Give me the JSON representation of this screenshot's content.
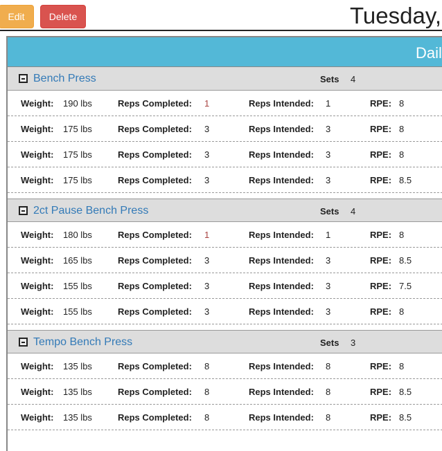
{
  "toolbar": {
    "edit_label": "Edit",
    "delete_label": "Delete"
  },
  "header": {
    "title": "Tuesday,"
  },
  "panel": {
    "title": "Dail"
  },
  "labels": {
    "weight": "Weight:",
    "reps_completed": "Reps Completed:",
    "reps_intended": "Reps Intended:",
    "rpe": "RPE:",
    "sets": "Sets"
  },
  "colors": {
    "panel_header": "#53b8d7",
    "link": "#337ab7",
    "edit": "#f0ad4e",
    "delete": "#d9534f",
    "incomplete": "#a94442"
  },
  "sections": [
    {
      "name": "Bench Press",
      "sets": "4",
      "rows": [
        {
          "weight": "190 lbs",
          "completed": "1",
          "intended": "1",
          "rpe": "8",
          "highlight": true
        },
        {
          "weight": "175 lbs",
          "completed": "3",
          "intended": "3",
          "rpe": "8"
        },
        {
          "weight": "175 lbs",
          "completed": "3",
          "intended": "3",
          "rpe": "8"
        },
        {
          "weight": "175 lbs",
          "completed": "3",
          "intended": "3",
          "rpe": "8.5"
        }
      ]
    },
    {
      "name": "2ct Pause Bench Press",
      "sets": "4",
      "rows": [
        {
          "weight": "180 lbs",
          "completed": "1",
          "intended": "1",
          "rpe": "8",
          "highlight": true
        },
        {
          "weight": "165 lbs",
          "completed": "3",
          "intended": "3",
          "rpe": "8.5"
        },
        {
          "weight": "155 lbs",
          "completed": "3",
          "intended": "3",
          "rpe": "7.5"
        },
        {
          "weight": "155 lbs",
          "completed": "3",
          "intended": "3",
          "rpe": "8"
        }
      ]
    },
    {
      "name": "Tempo Bench Press",
      "sets": "3",
      "rows": [
        {
          "weight": "135 lbs",
          "completed": "8",
          "intended": "8",
          "rpe": "8"
        },
        {
          "weight": "135 lbs",
          "completed": "8",
          "intended": "8",
          "rpe": "8.5"
        },
        {
          "weight": "135 lbs",
          "completed": "8",
          "intended": "8",
          "rpe": "8.5"
        }
      ]
    }
  ]
}
